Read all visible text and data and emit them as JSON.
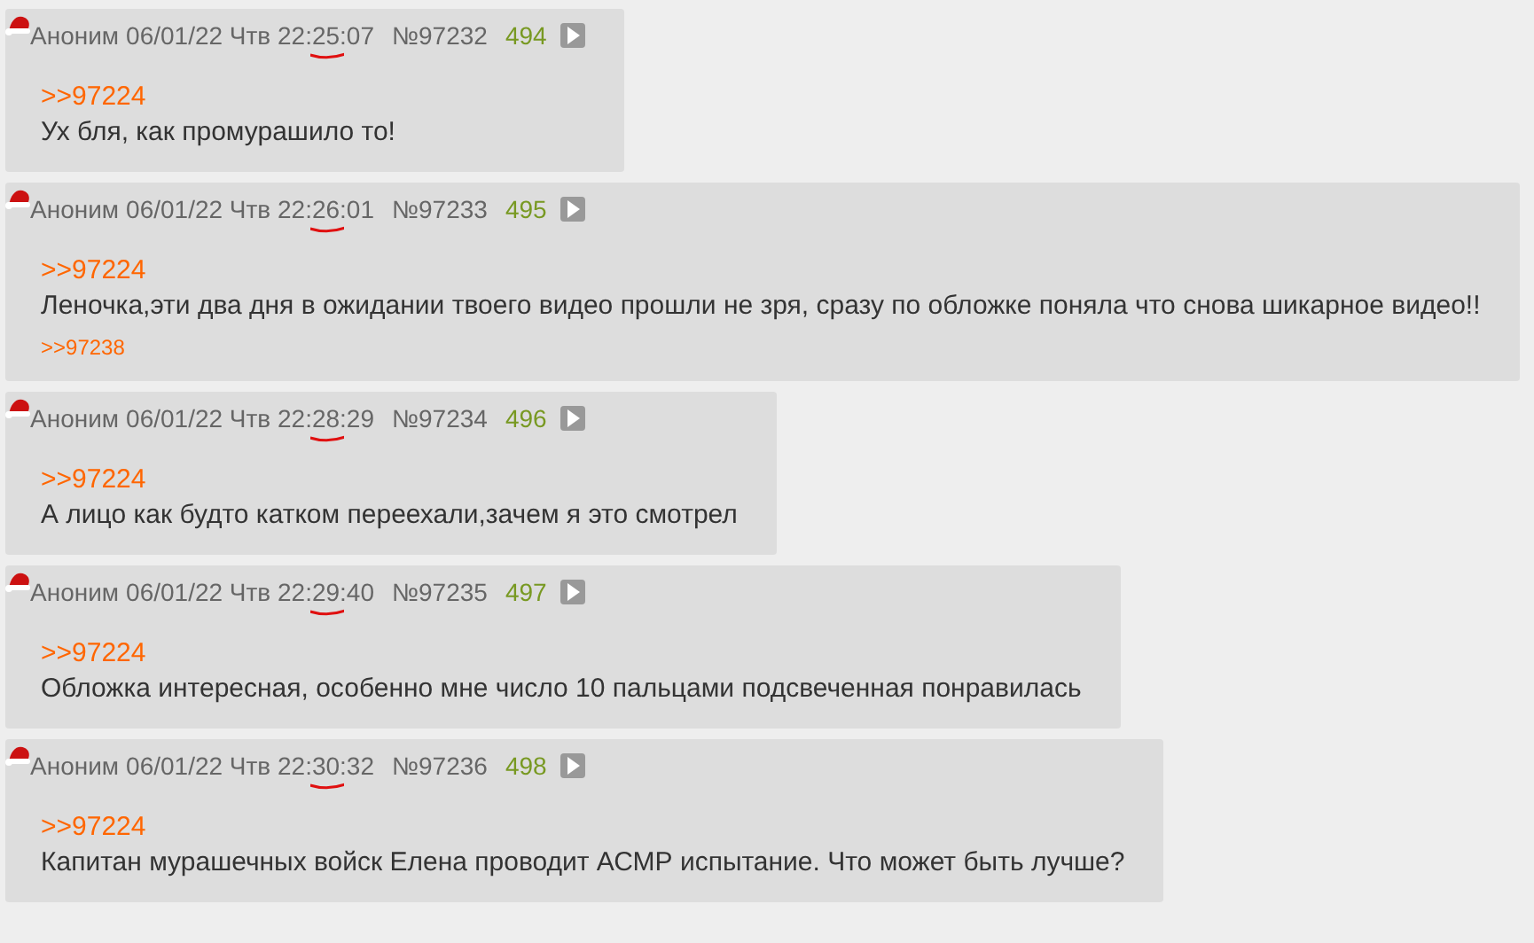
{
  "posts": [
    {
      "name": "Аноним",
      "date": "06/01/22 Чтв 22:25:07",
      "number": "№97232",
      "index": "494",
      "time_underlined": true,
      "reply_link": ">>97224",
      "text": "Ух бля, как промурашило то!"
    },
    {
      "name": "Аноним",
      "date": "06/01/22 Чтв 22:26:01",
      "number": "№97233",
      "index": "495",
      "time_underlined": true,
      "reply_link": ">>97224",
      "text": "Леночка,эти два дня в ожидании твоего видео прошли не зря, сразу по обложке поняла что снова шикарное видео!!",
      "backlinks": [
        ">>97238"
      ]
    },
    {
      "name": "Аноним",
      "date": "06/01/22 Чтв 22:28:29",
      "number": "№97234",
      "index": "496",
      "time_underlined": true,
      "reply_link": ">>97224",
      "text": "А лицо как будто катком переехали,зачем я это смотрел"
    },
    {
      "name": "Аноним",
      "date": "06/01/22 Чтв 22:29:40",
      "number": "№97235",
      "index": "497",
      "time_underlined": true,
      "reply_link": ">>97224",
      "text": "Обложка интересная, особенно мне число 10 пальцами подсвеченная понравилась"
    },
    {
      "name": "Аноним",
      "date": "06/01/22 Чтв 22:30:32",
      "number": "№97236",
      "index": "498",
      "time_underlined": true,
      "reply_link": ">>97224",
      "text": "Капитан мурашечных войск Елена проводит АСМР испытание. Что может быть лучше?"
    }
  ]
}
